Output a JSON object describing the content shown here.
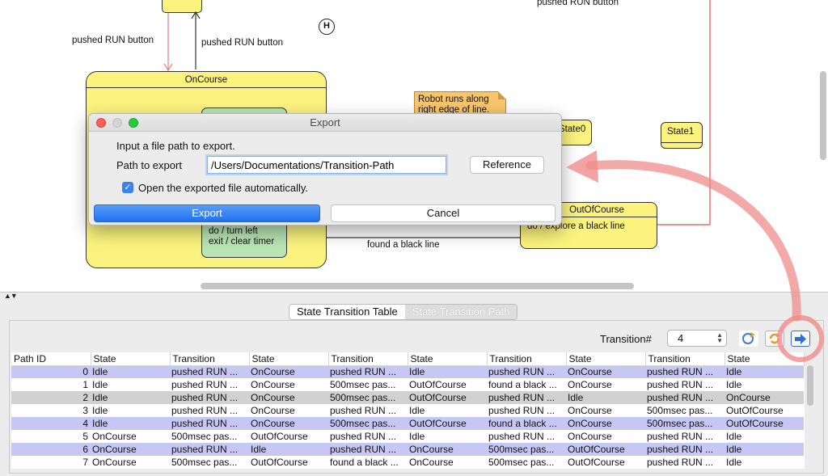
{
  "diagram": {
    "transition_labels": [
      "pushed RUN button",
      "pushed RUN button",
      "pushed RUN button",
      "found a black line"
    ],
    "history_marker": "H",
    "state_oncourse": "OnCourse",
    "inner_actions": [
      "do / turn left",
      "exit / clear timer"
    ],
    "note": [
      "Robot runs along",
      "right edge of line."
    ],
    "state0": "State0",
    "state1": "State1",
    "state_outofcourse": "OutOfCourse",
    "outofcourse_action": "do / explore a black line"
  },
  "export_dialog": {
    "title": "Export",
    "prompt": "Input a file path to export.",
    "path_label": "Path to export",
    "path_value": "/Users/Documentations/Transition-Path",
    "reference_button": "Reference",
    "checkbox_label": "Open the exported file automatically.",
    "checkbox_checked": true,
    "export_button": "Export",
    "cancel_button": "Cancel"
  },
  "panel": {
    "tabs": [
      "State Transition Table",
      "State Transition Path"
    ],
    "active_tab": "State Transition Table",
    "transition_label": "Transition#",
    "transition_value": "4",
    "toolbar_icons": [
      "settings-arrows-icon",
      "refresh-icon",
      "export-icon"
    ]
  },
  "table": {
    "headers": [
      "Path ID",
      "State",
      "Transition",
      "State",
      "Transition",
      "State",
      "Transition",
      "State",
      "Transition",
      "State"
    ],
    "rows": [
      [
        "0",
        "Idle",
        "pushed RUN ...",
        "OnCourse",
        "pushed RUN ...",
        "Idle",
        "pushed RUN ...",
        "OnCourse",
        "pushed RUN ...",
        "Idle"
      ],
      [
        "1",
        "Idle",
        "pushed RUN ...",
        "OnCourse",
        "500msec pas...",
        "OutOfCourse",
        "found a black ...",
        "OnCourse",
        "pushed RUN ...",
        "Idle"
      ],
      [
        "2",
        "Idle",
        "pushed RUN ...",
        "OnCourse",
        "500msec pas...",
        "OutOfCourse",
        "pushed RUN ...",
        "Idle",
        "pushed RUN ...",
        "OnCourse"
      ],
      [
        "3",
        "Idle",
        "pushed RUN ...",
        "OnCourse",
        "pushed RUN ...",
        "Idle",
        "pushed RUN ...",
        "OnCourse",
        "500msec pas...",
        "OutOfCourse"
      ],
      [
        "4",
        "Idle",
        "pushed RUN ...",
        "OnCourse",
        "500msec pas...",
        "OutOfCourse",
        "found a black ...",
        "OnCourse",
        "500msec pas...",
        "OutOfCourse"
      ],
      [
        "5",
        "OnCourse",
        "500msec pas...",
        "OutOfCourse",
        "pushed RUN ...",
        "Idle",
        "pushed RUN ...",
        "OnCourse",
        "pushed RUN ...",
        "Idle"
      ],
      [
        "6",
        "OnCourse",
        "pushed RUN ...",
        "Idle",
        "pushed RUN ...",
        "OnCourse",
        "500msec pas...",
        "OutOfCourse",
        "pushed RUN ...",
        "Idle"
      ],
      [
        "7",
        "OnCourse",
        "500msec pas...",
        "OutOfCourse",
        "found a black ...",
        "OnCourse",
        "500msec pas...",
        "OutOfCourse",
        "pushed RUN ...",
        "Idle"
      ]
    ],
    "row_highlights": [
      "blue",
      "",
      "gray",
      "",
      "blue",
      "",
      "blue",
      ""
    ]
  },
  "colors": {
    "state_fill": "#fbf37e",
    "inner_state_fill": "#b9e4b4",
    "note_fill": "#f6c56c",
    "highlight_arrow": "#f08c8c",
    "selected_row": "#c7c7f5",
    "export_button": "#1e6ff0"
  }
}
